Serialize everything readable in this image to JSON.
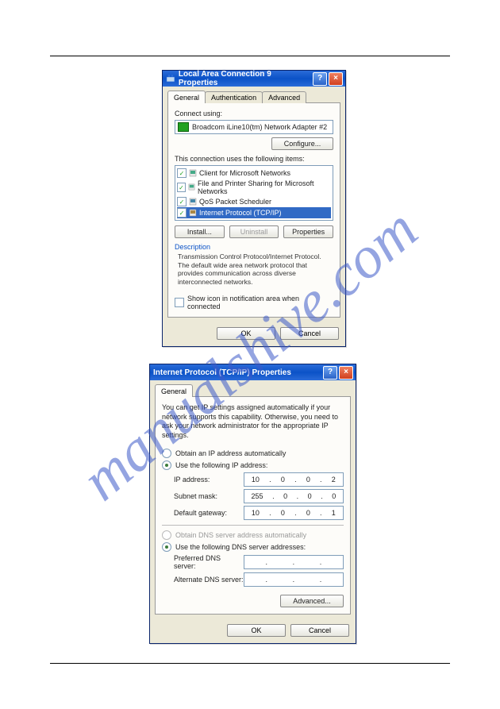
{
  "watermark": "manualshive.com",
  "dialog1": {
    "title": "Local Area Connection 9 Properties",
    "tabs": [
      "General",
      "Authentication",
      "Advanced"
    ],
    "connect_using_label": "Connect using:",
    "adapter": "Broadcom iLine10(tm) Network Adapter #2",
    "configure_btn": "Configure...",
    "items_label": "This connection uses the following items:",
    "items": [
      {
        "checked": true,
        "label": "Client for Microsoft Networks"
      },
      {
        "checked": true,
        "label": "File and Printer Sharing for Microsoft Networks"
      },
      {
        "checked": true,
        "label": "QoS Packet Scheduler"
      },
      {
        "checked": true,
        "label": "Internet Protocol (TCP/IP)",
        "selected": true
      }
    ],
    "install_btn": "Install...",
    "uninstall_btn": "Uninstall",
    "properties_btn": "Properties",
    "desc_label": "Description",
    "desc_text": "Transmission Control Protocol/Internet Protocol. The default wide area network protocol that provides communication across diverse interconnected networks.",
    "show_icon_checked": false,
    "show_icon_label": "Show icon in notification area when connected",
    "ok": "OK",
    "cancel": "Cancel"
  },
  "dialog2": {
    "title": "Internet Protocol (TCP/IP) Properties",
    "tab": "General",
    "intro": "You can get IP settings assigned automatically if your network supports this capability. Otherwise, you need to ask your network administrator for the appropriate IP settings.",
    "r_auto_ip": "Obtain an IP address automatically",
    "r_use_ip": "Use the following IP address:",
    "ip_label": "IP address:",
    "ip": [
      "10",
      "0",
      "0",
      "2"
    ],
    "subnet_label": "Subnet mask:",
    "subnet": [
      "255",
      "0",
      "0",
      "0"
    ],
    "gateway_label": "Default gateway:",
    "gateway": [
      "10",
      "0",
      "0",
      "1"
    ],
    "r_auto_dns": "Obtain DNS server address automatically",
    "r_use_dns": "Use the following DNS server addresses:",
    "pref_dns_label": "Preferred DNS server:",
    "pref_dns": [
      "",
      "",
      "",
      ""
    ],
    "alt_dns_label": "Alternate DNS server:",
    "alt_dns": [
      "",
      "",
      "",
      ""
    ],
    "advanced_btn": "Advanced...",
    "ok": "OK",
    "cancel": "Cancel"
  }
}
